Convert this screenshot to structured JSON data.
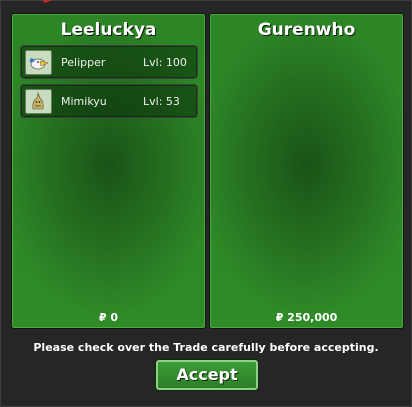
{
  "trade": {
    "left": {
      "player_name": "Leeluckya",
      "money": "₽ 0",
      "pokemon": [
        {
          "name": "Pelipper",
          "level": "Lvl: 100",
          "icon": "pelipper-icon"
        },
        {
          "name": "Mimikyu",
          "level": "Lvl: 53",
          "icon": "mimikyu-icon"
        }
      ]
    },
    "right": {
      "player_name": "Gurenwho",
      "money": "₽ 250,000",
      "pokemon": []
    },
    "notice": "Please check over the Trade carefully before accepting.",
    "accept_label": "Accept"
  },
  "colors": {
    "panel_green": "#2f8a28",
    "panel_border": "#4da83f",
    "window_bg": "#262626",
    "button_green": "#3c9c36"
  }
}
